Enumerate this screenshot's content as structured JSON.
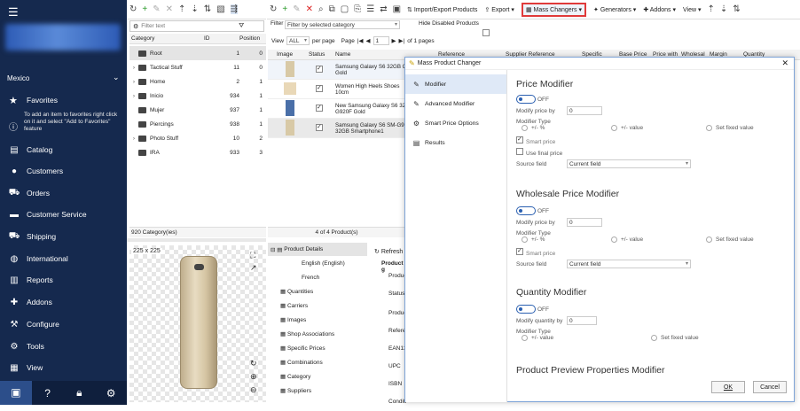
{
  "nav": {
    "region": "Mexico",
    "favorites": "Favorites",
    "fav_hint": "To add an item to favorites right click on it and select \"Add to Favorites\" feature",
    "items": [
      "Catalog",
      "Customers",
      "Orders",
      "Customer Service",
      "Shipping",
      "International",
      "Reports",
      "Addons",
      "Configure",
      "Tools",
      "View"
    ]
  },
  "toolbar": {
    "import_export": "Import/Export Products",
    "export": "Export",
    "mass_changers": "Mass Changers",
    "generators": "Generators",
    "addons": "Addons",
    "view": "View"
  },
  "categories": {
    "filter_placeholder": "Filter text",
    "headers": {
      "category": "Category",
      "id": "ID",
      "position": "Position"
    },
    "rows": [
      {
        "name": "Root",
        "id": "1",
        "pos": "0"
      },
      {
        "name": "Tactical Stuff",
        "id": "11",
        "pos": "0"
      },
      {
        "name": "Home",
        "id": "2",
        "pos": "1"
      },
      {
        "name": "Inicio",
        "id": "934",
        "pos": "1"
      },
      {
        "name": "Mujer",
        "id": "937",
        "pos": "1"
      },
      {
        "name": "Piercings",
        "id": "938",
        "pos": "1"
      },
      {
        "name": "Photo Stuff",
        "id": "10",
        "pos": "2"
      },
      {
        "name": "IRA",
        "id": "933",
        "pos": "3"
      }
    ],
    "footer": "920 Category(ies)"
  },
  "products": {
    "filter_label": "Filter",
    "filter_value": "Filter by selected category",
    "hide_disabled": "Hide Disabled Products",
    "view_label": "View",
    "view_value": "ALL",
    "per_page": "per page",
    "page_label": "Page",
    "page_value": "1",
    "of_pages": "of 1 pages",
    "headers": {
      "image": "Image",
      "status": "Status",
      "name": "Name",
      "reference": "Reference",
      "supplier_ref": "Supplier Reference",
      "specific": "Specific",
      "base_price": "Base Price",
      "price_with": "Price with",
      "wholesale": "Wholesal",
      "margin": "Margin",
      "quantity": "Quantity"
    },
    "rows": [
      {
        "name": "Samsung Galaxy S6 32GB G Gold"
      },
      {
        "name": "Women High Heels Shoes 10cm"
      },
      {
        "name": "New Samsung Galaxy S6 32 G920F Gold"
      },
      {
        "name": "Samsung Galaxy S6 SM-G9 32GB Smartphone1"
      }
    ],
    "footer": "4 of 4 Product(s)"
  },
  "preview": {
    "size": "225 x 225"
  },
  "details": {
    "tree": [
      "Product Details",
      "English (English)",
      "French",
      "Quantities",
      "Carriers",
      "Images",
      "Shop Associations",
      "Specific Prices",
      "Combinations",
      "Category",
      "Suppliers"
    ],
    "refresh": "Refresh",
    "fields": [
      "Product g",
      "Produc",
      "Status",
      "Produc",
      "Referen",
      "EAN13",
      "UPC",
      "ISBN",
      "Conditi"
    ]
  },
  "dialog": {
    "title": "Mass Product Changer",
    "side": [
      "Modifier",
      "Advanced Modifier",
      "Smart Price Options",
      "Results"
    ],
    "price": {
      "heading": "Price Modifier",
      "off": "OFF",
      "modify_by": "Modify price by",
      "value": "0",
      "modifier_type": "Modifier Type",
      "opt1": "+/- %",
      "opt2": "+/- value",
      "opt3": "Set fixed value",
      "smart": "Smart price",
      "final": "Use final price",
      "source": "Source field",
      "source_value": "Current field"
    },
    "wholesale": {
      "heading": "Wholesale Price Modifier",
      "off": "OFF",
      "modify_by": "Modify price by",
      "value": "0",
      "modifier_type": "Modifier Type",
      "opt1": "+/- %",
      "opt2": "+/- value",
      "opt3": "Set fixed value",
      "smart": "Smart price",
      "source": "Source field",
      "source_value": "Current field"
    },
    "quantity": {
      "heading": "Quantity Modifier",
      "off": "OFF",
      "modify_by": "Modify quantity by",
      "value": "0",
      "modifier_type": "Modifier Type",
      "opt1": "+/- value",
      "opt2": "Set fixed value"
    },
    "next_heading": "Product Preview Properties Modifier",
    "ok": "OK",
    "cancel": "Cancel"
  },
  "colors": {
    "nav_bg": "#15294e",
    "highlight": "#e03a3a",
    "dialog_border": "#7ea4d8"
  }
}
